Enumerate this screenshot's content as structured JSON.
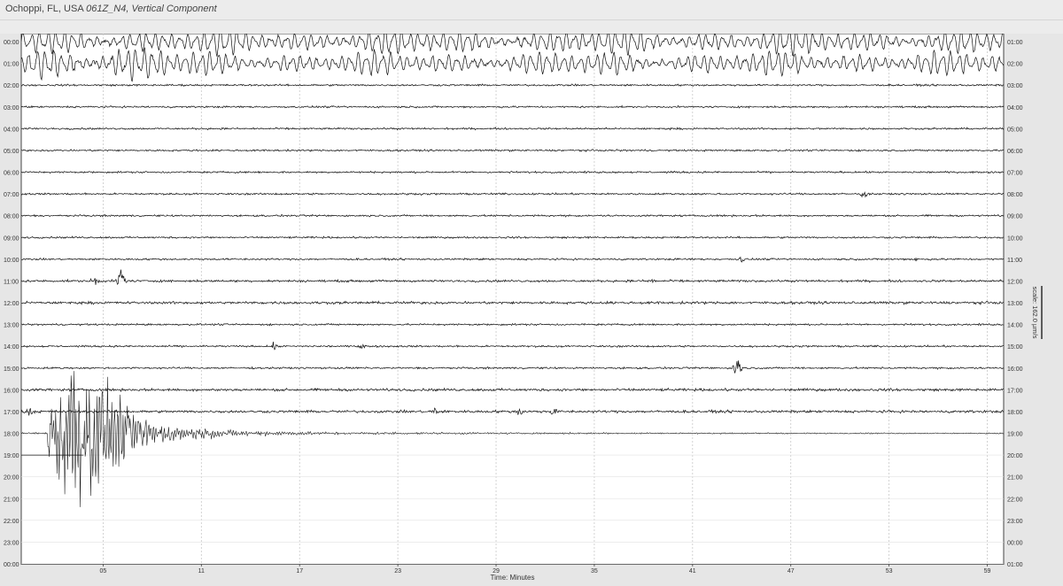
{
  "title": {
    "location": "Ochoppi, FL, USA",
    "station": "061Z_N4",
    "component": "Vertical Component"
  },
  "colors": {
    "trace": "#111111",
    "grid": "#c8c8c8",
    "plot_background": "#ffffff",
    "frame": "#444444"
  },
  "chart_data": {
    "type": "line",
    "title": "Ochoppi, FL, USA 061Z_N4, Vertical Component",
    "xlabel": "Time: Minutes",
    "xlim": [
      0,
      60
    ],
    "x_ticks": [
      "05",
      "11",
      "17",
      "23",
      "29",
      "35",
      "41",
      "47",
      "53",
      "59"
    ],
    "x_tick_values": [
      5,
      11,
      17,
      23,
      29,
      35,
      41,
      47,
      53,
      59
    ],
    "left_labels": [
      "00:00",
      "01:00",
      "02:00",
      "03:00",
      "04:00",
      "05:00",
      "06:00",
      "07:00",
      "08:00",
      "09:00",
      "10:00",
      "11:00",
      "12:00",
      "13:00",
      "14:00",
      "15:00",
      "16:00",
      "17:00",
      "18:00",
      "19:00",
      "20:00",
      "21:00",
      "22:00",
      "23:00",
      "00:00"
    ],
    "right_labels": [
      "01:00",
      "02:00",
      "03:00",
      "04:00",
      "05:00",
      "06:00",
      "07:00",
      "08:00",
      "09:00",
      "10:00",
      "11:00",
      "12:00",
      "13:00",
      "14:00",
      "15:00",
      "16:00",
      "17:00",
      "18:00",
      "19:00",
      "20:00",
      "21:00",
      "22:00",
      "23:00",
      "00:00",
      "01:00"
    ],
    "scale_label": "scale: 162.0 µm/s",
    "grid": true,
    "traces": [
      {
        "row": 0,
        "kind": "microseism",
        "amp": 0.9
      },
      {
        "row": 1,
        "kind": "microseism",
        "amp": 0.85
      },
      {
        "row": 2,
        "kind": "noise",
        "amp": 0.05
      },
      {
        "row": 3,
        "kind": "noise",
        "amp": 0.05
      },
      {
        "row": 4,
        "kind": "noise",
        "amp": 0.05
      },
      {
        "row": 5,
        "kind": "noise",
        "amp": 0.05
      },
      {
        "row": 6,
        "kind": "noise",
        "amp": 0.05
      },
      {
        "row": 7,
        "kind": "noise",
        "amp": 0.05,
        "spikes": [
          {
            "x": 51.5,
            "amp": 0.12
          }
        ]
      },
      {
        "row": 8,
        "kind": "noise",
        "amp": 0.05
      },
      {
        "row": 9,
        "kind": "noise",
        "amp": 0.05
      },
      {
        "row": 10,
        "kind": "noise",
        "amp": 0.05,
        "spikes": [
          {
            "x": 44,
            "amp": 0.1
          },
          {
            "x": 54.5,
            "amp": 0.1
          }
        ]
      },
      {
        "row": 11,
        "kind": "noise",
        "amp": 0.06,
        "spikes": [
          {
            "x": 6.1,
            "amp": 0.5
          },
          {
            "x": 4.5,
            "amp": 0.12
          },
          {
            "x": 38.5,
            "amp": 0.12
          }
        ]
      },
      {
        "row": 12,
        "kind": "noise",
        "amp": 0.07
      },
      {
        "row": 13,
        "kind": "noise",
        "amp": 0.05
      },
      {
        "row": 14,
        "kind": "noise",
        "amp": 0.05,
        "spikes": [
          {
            "x": 15.5,
            "amp": 0.12
          },
          {
            "x": 20.8,
            "amp": 0.1
          }
        ]
      },
      {
        "row": 15,
        "kind": "noise",
        "amp": 0.05,
        "spikes": [
          {
            "x": 43.7,
            "amp": 0.4
          }
        ]
      },
      {
        "row": 16,
        "kind": "noise",
        "amp": 0.07
      },
      {
        "row": 17,
        "kind": "noise",
        "amp": 0.07,
        "spikes": [
          {
            "x": 0.5,
            "amp": 0.15
          },
          {
            "x": 25.3,
            "amp": 0.15
          },
          {
            "x": 30.5,
            "amp": 0.15
          },
          {
            "x": 32.5,
            "amp": 0.12
          }
        ]
      },
      {
        "row": 18,
        "kind": "earthquake",
        "onset": 1.6,
        "peak_amp": 5.5,
        "decay_end": 60
      },
      {
        "row": 19,
        "kind": "flat_segment",
        "x_end": 3.8
      }
    ]
  }
}
